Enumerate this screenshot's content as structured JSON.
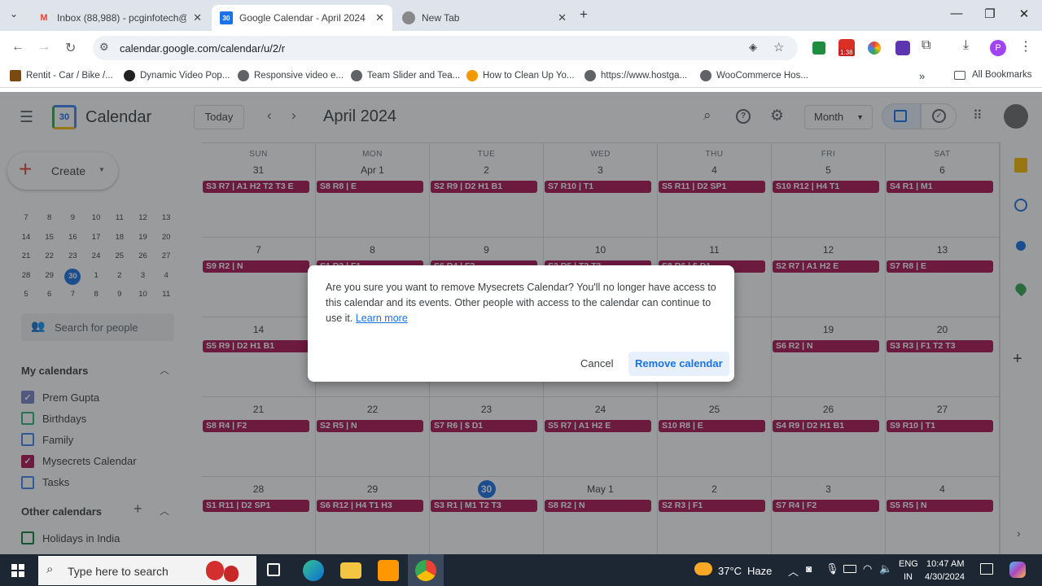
{
  "browser": {
    "tabs": [
      {
        "title": "Inbox (88,988) - pcginfotech@g",
        "favicon": "gmail-icon",
        "color": "#ea4335"
      },
      {
        "title": "Google Calendar - April 2024",
        "favicon": "calendar-icon",
        "color": "#1a73e8"
      },
      {
        "title": "New Tab",
        "favicon": "chrome-icon",
        "color": "#5f6368"
      }
    ],
    "url": "calendar.google.com/calendar/u/2/r",
    "bookmarks": [
      {
        "label": "Rentit - Car / Bike /...",
        "color": "#7b4a12"
      },
      {
        "label": "Dynamic Video Pop...",
        "color": "#222222"
      },
      {
        "label": "Responsive video e...",
        "color": "#5f6368"
      },
      {
        "label": "Team Slider and Tea...",
        "color": "#5f6368"
      },
      {
        "label": "How to Clean Up Yo...",
        "color": "#f29900"
      },
      {
        "label": "https://www.hostga...",
        "color": "#5f6368"
      },
      {
        "label": "WooCommerce Hos...",
        "color": "#5f6368"
      }
    ],
    "all_bookmarks": "All Bookmarks",
    "ext_badge": "1:38",
    "profile_initial": "P"
  },
  "app": {
    "name": "Calendar",
    "logo_num": "30",
    "today_btn": "Today",
    "month_title": "April 2024",
    "view_select": "Month",
    "create_label": "Create",
    "search_people": "Search for people",
    "my_calendars_title": "My calendars",
    "other_calendars_title": "Other calendars",
    "my_calendars": [
      {
        "name": "Prem Gupta",
        "color": "#7986cb",
        "checked": true
      },
      {
        "name": "Birthdays",
        "color": "#33b679",
        "checked": false
      },
      {
        "name": "Family",
        "color": "#4285f4",
        "checked": false
      },
      {
        "name": "Mysecrets Calendar",
        "color": "#ad1457",
        "checked": true
      },
      {
        "name": "Tasks",
        "color": "#4285f4",
        "checked": false
      }
    ],
    "other_calendars": [
      {
        "name": "Holidays in India",
        "color": "#0b8043",
        "checked": false
      }
    ],
    "mini_rows": [
      [
        "7",
        "8",
        "9",
        "10",
        "11",
        "12",
        "13"
      ],
      [
        "14",
        "15",
        "16",
        "17",
        "18",
        "19",
        "20"
      ],
      [
        "21",
        "22",
        "23",
        "24",
        "25",
        "26",
        "27"
      ],
      [
        "28",
        "29",
        "30",
        "1",
        "2",
        "3",
        "4"
      ],
      [
        "5",
        "6",
        "7",
        "8",
        "9",
        "10",
        "11"
      ]
    ]
  },
  "calendar": {
    "weekdays": [
      "SUN",
      "MON",
      "TUE",
      "WED",
      "THU",
      "FRI",
      "SAT"
    ],
    "weeks": [
      [
        {
          "d": "31",
          "e": "S3 R7 | A1 H2 T2 T3 E"
        },
        {
          "d": "Apr 1",
          "e": "S8 R8 | E"
        },
        {
          "d": "2",
          "e": "S2 R9 | D2 H1 B1"
        },
        {
          "d": "3",
          "e": "S7 R10 | T1"
        },
        {
          "d": "4",
          "e": "S5 R11 | D2 SP1"
        },
        {
          "d": "5",
          "e": "S10 R12 | H4 T1"
        },
        {
          "d": "6",
          "e": "S4 R1 | M1"
        }
      ],
      [
        {
          "d": "7",
          "e": "S9 R2 | N"
        },
        {
          "d": "8",
          "e": "S1 R3 | F1"
        },
        {
          "d": "9",
          "e": "S6 R4 | F2"
        },
        {
          "d": "10",
          "e": "S3 R5 | T2 T3"
        },
        {
          "d": "11",
          "e": "S8 R6 | $ D1"
        },
        {
          "d": "12",
          "e": "S2 R7 | A1 H2 E"
        },
        {
          "d": "13",
          "e": "S7 R8 | E"
        }
      ],
      [
        {
          "d": "14",
          "e": "S5 R9 | D2 H1 B1"
        },
        {
          "d": "15",
          "e": ""
        },
        {
          "d": "16",
          "e": ""
        },
        {
          "d": "17",
          "e": ""
        },
        {
          "d": "18",
          "e": ""
        },
        {
          "d": "19",
          "e": "S6 R2 | N"
        },
        {
          "d": "20",
          "e": "S3 R3 | F1 T2 T3"
        }
      ],
      [
        {
          "d": "21",
          "e": "S8 R4 | F2"
        },
        {
          "d": "22",
          "e": "S2 R5 | N"
        },
        {
          "d": "23",
          "e": "S7 R6 | $ D1"
        },
        {
          "d": "24",
          "e": "S5 R7 | A1 H2 E"
        },
        {
          "d": "25",
          "e": "S10 R8 | E"
        },
        {
          "d": "26",
          "e": "S4 R9 | D2 H1 B1"
        },
        {
          "d": "27",
          "e": "S9 R10 | T1"
        }
      ],
      [
        {
          "d": "28",
          "e": "S1 R11 | D2 SP1"
        },
        {
          "d": "29",
          "e": "S6 R12 | H4 T1 H3"
        },
        {
          "d": "30",
          "e": "S3 R1 | M1 T2 T3",
          "today": true
        },
        {
          "d": "May 1",
          "e": "S8 R2 | N"
        },
        {
          "d": "2",
          "e": "S2 R3 | F1"
        },
        {
          "d": "3",
          "e": "S7 R4 | F2"
        },
        {
          "d": "4",
          "e": "S5 R5 | N"
        }
      ]
    ]
  },
  "dialog": {
    "message": "Are you sure you want to remove Mysecrets Calendar? You'll no longer have access to this calendar and its events. Other people with access to the calendar can continue to use it.",
    "learn_more": "Learn more",
    "cancel": "Cancel",
    "confirm": "Remove calendar"
  },
  "taskbar": {
    "search_placeholder": "Type here to search",
    "weather_temp": "37°C",
    "weather_text": "Haze",
    "lang": "ENG",
    "region": "IN",
    "time": "10:47 AM",
    "date": "4/30/2024"
  },
  "colors": {
    "event": "#ad1457",
    "accent": "#1a73e8"
  }
}
